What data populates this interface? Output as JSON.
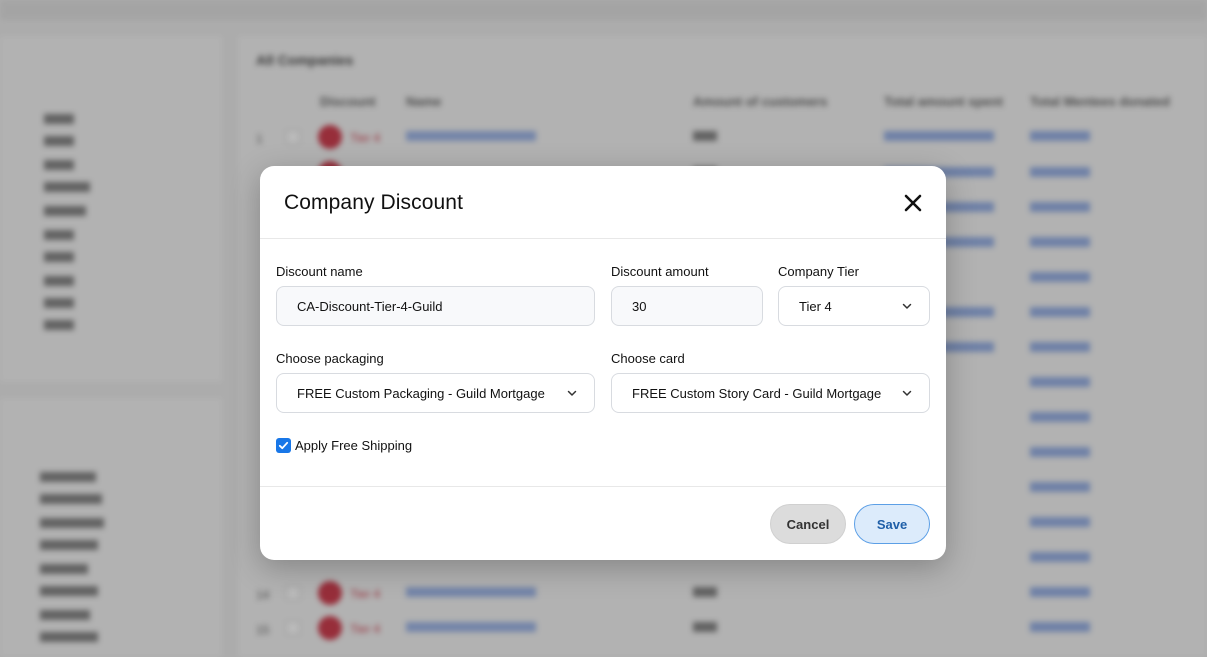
{
  "modal": {
    "title": "Company Discount",
    "fields": {
      "discount_name": {
        "label": "Discount name",
        "value": "CA-Discount-Tier-4-Guild"
      },
      "discount_amount": {
        "label": "Discount amount",
        "value": "30"
      },
      "company_tier": {
        "label": "Company Tier",
        "value": "Tier 4"
      },
      "packaging": {
        "label": "Choose packaging",
        "value": "FREE Custom Packaging - Guild Mortgage"
      },
      "card": {
        "label": "Choose card",
        "value": "FREE Custom Story Card - Guild Mortgage"
      }
    },
    "free_shipping": {
      "label": "Apply Free Shipping",
      "checked": true
    },
    "buttons": {
      "cancel": "Cancel",
      "save": "Save"
    }
  },
  "background": {
    "main_title": "All Companies",
    "columns": [
      "Discount",
      "Name",
      "Amount of customers",
      "Total amount spent",
      "Total Mentees donated"
    ],
    "rows": [
      {
        "num": "1",
        "tier": "Tier 4"
      },
      {
        "num": "14",
        "tier": "Tier 4"
      },
      {
        "num": "15",
        "tier": "Tier 4"
      }
    ]
  },
  "colors": {
    "accent": "#1877e8",
    "tier_red": "#c8273a",
    "save_border": "#5c9fe6"
  }
}
